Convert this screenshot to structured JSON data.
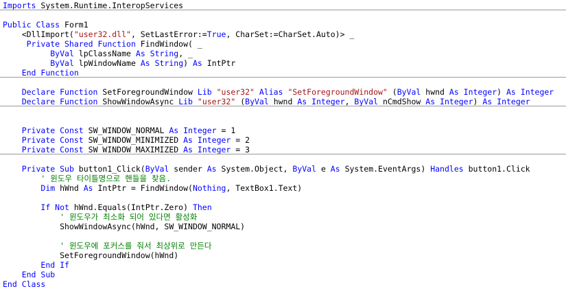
{
  "colors": {
    "keyword": "#0000ff",
    "string": "#a31515",
    "comment": "#008000",
    "text": "#000000",
    "separator": "#999999"
  },
  "lines": [
    [
      [
        "kw",
        "Imports"
      ],
      [
        "",
        "System.Runtime.InteropServices"
      ]
    ],
    [],
    [
      [
        "kw",
        "Public Class"
      ],
      [
        "",
        "Form1"
      ]
    ],
    [
      [
        "",
        "    <DllImport("
      ],
      [
        "str",
        "\"user32.dll\""
      ],
      [
        "",
        ", SetLastError:="
      ],
      [
        "kw",
        "True"
      ],
      [
        "",
        ", CharSet:=CharSet.Auto)> _"
      ]
    ],
    [
      [
        "",
        "     "
      ],
      [
        "kw",
        "Private Shared Function"
      ],
      [
        "",
        "FindWindow( _"
      ]
    ],
    [
      [
        "",
        "          "
      ],
      [
        "kw",
        "ByVal"
      ],
      [
        "",
        "lpClassName "
      ],
      [
        "kw",
        "As String"
      ],
      [
        "",
        ", _"
      ]
    ],
    [
      [
        "",
        "          "
      ],
      [
        "kw",
        "ByVal"
      ],
      [
        "",
        "lpWindowName "
      ],
      [
        "kw",
        "As String"
      ],
      [
        "",
        ") "
      ],
      [
        "kw",
        "As"
      ],
      [
        "",
        "IntPtr"
      ]
    ],
    [
      [
        "",
        "    "
      ],
      [
        "kw",
        "End Function"
      ]
    ],
    [],
    [
      [
        "",
        "    "
      ],
      [
        "kw",
        "Declare Function"
      ],
      [
        "",
        "SetForegroundWindow "
      ],
      [
        "kw",
        "Lib"
      ],
      [
        "str",
        "\"user32\""
      ],
      [
        "kw",
        "Alias"
      ],
      [
        "str",
        "\"SetForegroundWindow\""
      ],
      [
        "",
        "("
      ],
      [
        "kw",
        "ByVal"
      ],
      [
        "",
        "hwnd "
      ],
      [
        "kw",
        "As Integer"
      ],
      [
        "",
        ") "
      ],
      [
        "kw",
        "As Integer"
      ]
    ],
    [
      [
        "",
        "    "
      ],
      [
        "kw",
        "Declare Function"
      ],
      [
        "",
        "ShowWindowAsync "
      ],
      [
        "kw",
        "Lib"
      ],
      [
        "str",
        "\"user32\""
      ],
      [
        "",
        "("
      ],
      [
        "kw",
        "ByVal"
      ],
      [
        "",
        "hwnd "
      ],
      [
        "kw",
        "As Integer"
      ],
      [
        "",
        ", "
      ],
      [
        "kw",
        "ByVal"
      ],
      [
        "",
        "nCmdShow "
      ],
      [
        "kw",
        "As Integer"
      ],
      [
        "",
        ") "
      ],
      [
        "kw",
        "As Integer"
      ]
    ],
    [],
    [],
    [
      [
        "",
        "    "
      ],
      [
        "kw",
        "Private Const"
      ],
      [
        "",
        "SW_WINDOW_NORMAL "
      ],
      [
        "kw",
        "As Integer"
      ],
      [
        "",
        "= 1"
      ]
    ],
    [
      [
        "",
        "    "
      ],
      [
        "kw",
        "Private Const"
      ],
      [
        "",
        "SW_WINDOW_MINIMIZED "
      ],
      [
        "kw",
        "As Integer"
      ],
      [
        "",
        "= 2"
      ]
    ],
    [
      [
        "",
        "    "
      ],
      [
        "kw",
        "Private Const"
      ],
      [
        "",
        "SW_WINDOW_MAXIMIZED "
      ],
      [
        "kw",
        "As Integer"
      ],
      [
        "",
        "= 3"
      ]
    ],
    [],
    [
      [
        "",
        "    "
      ],
      [
        "kw",
        "Private Sub"
      ],
      [
        "",
        "button1_Click("
      ],
      [
        "kw",
        "ByVal"
      ],
      [
        "",
        "sender "
      ],
      [
        "kw",
        "As"
      ],
      [
        "",
        "System.Object, "
      ],
      [
        "kw",
        "ByVal"
      ],
      [
        "",
        "e "
      ],
      [
        "kw",
        "As"
      ],
      [
        "",
        "System.EventArgs) "
      ],
      [
        "kw",
        "Handles"
      ],
      [
        "",
        "button1.Click"
      ]
    ],
    [
      [
        "",
        "        "
      ],
      [
        "cmt",
        "' 윈도우 타이틀명으로 핸들을 찾음."
      ]
    ],
    [
      [
        "",
        "        "
      ],
      [
        "kw",
        "Dim"
      ],
      [
        "",
        "hWnd "
      ],
      [
        "kw",
        "As"
      ],
      [
        "",
        "IntPtr = FindWindow("
      ],
      [
        "kw",
        "Nothing"
      ],
      [
        "",
        ", TextBox1.Text)"
      ]
    ],
    [],
    [
      [
        "",
        "        "
      ],
      [
        "kw",
        "If Not"
      ],
      [
        "",
        "hWnd.Equals(IntPtr.Zero) "
      ],
      [
        "kw",
        "Then"
      ]
    ],
    [
      [
        "",
        "            "
      ],
      [
        "cmt",
        "' 윈도우가 최소화 되어 있다면 활성화"
      ]
    ],
    [
      [
        "",
        "            ShowWindowAsync(hWnd, SW_WINDOW_NORMAL)"
      ]
    ],
    [],
    [
      [
        "",
        "            "
      ],
      [
        "cmt",
        "' 윈도우에 포커스를 줘서 최상위로 만든다"
      ]
    ],
    [
      [
        "",
        "            SetForegroundWindow(hWnd)"
      ]
    ],
    [
      [
        "",
        "        "
      ],
      [
        "kw",
        "End If"
      ]
    ],
    [
      [
        "",
        "    "
      ],
      [
        "kw",
        "End Sub"
      ]
    ],
    [
      [
        "kw",
        "End Class"
      ]
    ]
  ]
}
